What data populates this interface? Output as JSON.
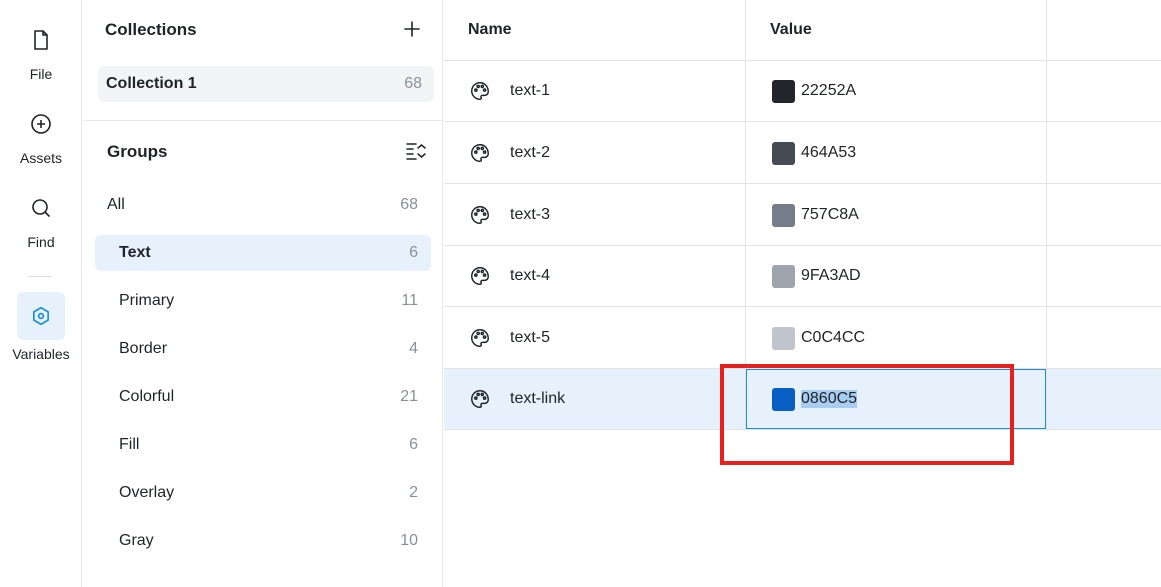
{
  "rail": {
    "file_label": "File",
    "assets_label": "Assets",
    "find_label": "Find",
    "variables_label": "Variables",
    "accent": "#1a8fd8"
  },
  "collections": {
    "title": "Collections",
    "items": [
      {
        "name": "Collection 1",
        "count": "68"
      }
    ]
  },
  "groups": {
    "title": "Groups",
    "items": [
      {
        "name": "All",
        "count": "68"
      },
      {
        "name": "Text",
        "count": "6",
        "selected": true
      },
      {
        "name": "Primary",
        "count": "11"
      },
      {
        "name": "Border",
        "count": "4"
      },
      {
        "name": "Colorful",
        "count": "21"
      },
      {
        "name": "Fill",
        "count": "6"
      },
      {
        "name": "Overlay",
        "count": "2"
      },
      {
        "name": "Gray",
        "count": "10"
      }
    ]
  },
  "table": {
    "headers": {
      "name": "Name",
      "value": "Value"
    },
    "rows": [
      {
        "name": "text-1",
        "value": "22252A",
        "color": "#22252A"
      },
      {
        "name": "text-2",
        "value": "464A53",
        "color": "#464A53"
      },
      {
        "name": "text-3",
        "value": "757C8A",
        "color": "#757C8A"
      },
      {
        "name": "text-4",
        "value": "9FA3AD",
        "color": "#9FA3AD"
      },
      {
        "name": "text-5",
        "value": "C0C4CC",
        "color": "#C0C4CC"
      },
      {
        "name": "text-link",
        "value": "0860C5",
        "color": "#0860C5",
        "selected": true
      }
    ]
  },
  "icons": {
    "file": "file-icon",
    "assets": "plus-circle-icon",
    "find": "search-icon",
    "variables": "hexagon-icon",
    "add": "plus-icon",
    "collapse": "collapse-list-icon",
    "row": "palette-icon"
  },
  "highlight_color": "#e8201c"
}
